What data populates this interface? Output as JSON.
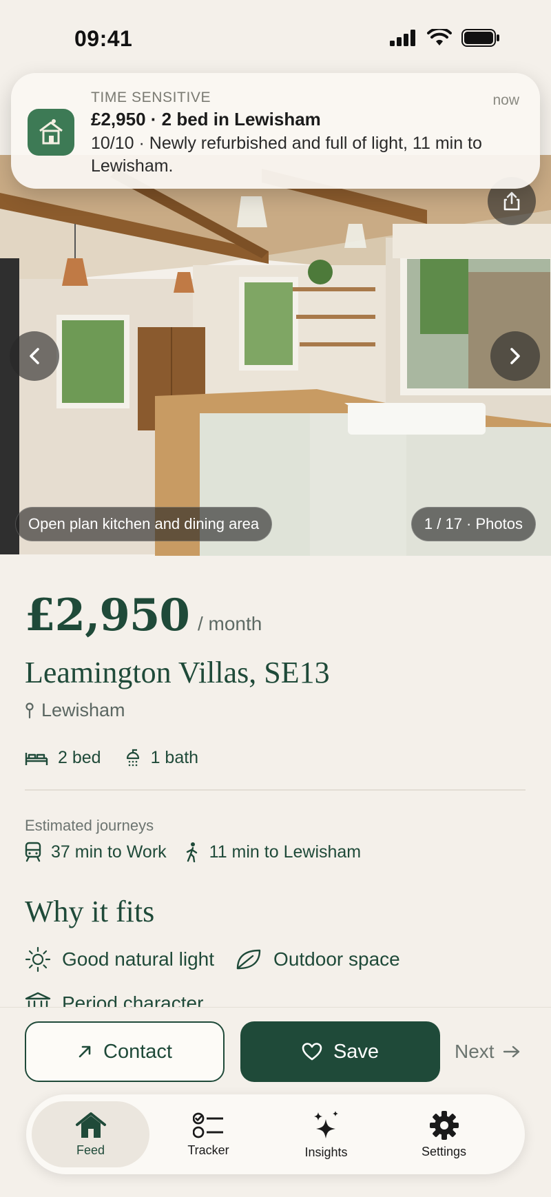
{
  "status_bar": {
    "time": "09:41"
  },
  "notification": {
    "label": "TIME SENSITIVE",
    "time": "now",
    "title": "£2,950 · 2 bed in Lewisham",
    "body": "10/10 · Newly refurbished and full of light, 11 min to Lewisham."
  },
  "hero": {
    "caption": "Open plan kitchen and dining area",
    "counter": "1 / 17 · Photos"
  },
  "listing": {
    "price": "£2,950",
    "price_unit": "/ month",
    "address": "Leamington Villas, SE13",
    "area": "Lewisham",
    "beds": "2 bed",
    "baths": "1 bath"
  },
  "journeys": {
    "label": "Estimated journeys",
    "items": [
      {
        "icon": "train-icon",
        "text": "37 min to Work"
      },
      {
        "icon": "walking-icon",
        "text": "11 min to Lewisham"
      }
    ]
  },
  "why_it_fits": {
    "title": "Why it fits",
    "items": [
      {
        "icon": "sun-icon",
        "text": "Good natural light"
      },
      {
        "icon": "leaf-icon",
        "text": "Outdoor space"
      },
      {
        "icon": "building-icon",
        "text": "Period character"
      }
    ]
  },
  "actions": {
    "contact": "Contact",
    "save": "Save",
    "next": "Next"
  },
  "tabs": [
    {
      "icon": "home-icon",
      "label": "Feed",
      "active": true
    },
    {
      "icon": "checklist-icon",
      "label": "Tracker",
      "active": false
    },
    {
      "icon": "sparkle-icon",
      "label": "Insights",
      "active": false
    },
    {
      "icon": "gear-icon",
      "label": "Settings",
      "active": false
    }
  ],
  "colors": {
    "brand": "#1f4a39",
    "background": "#f4f0ea",
    "notification_icon": "#3d7a55"
  }
}
